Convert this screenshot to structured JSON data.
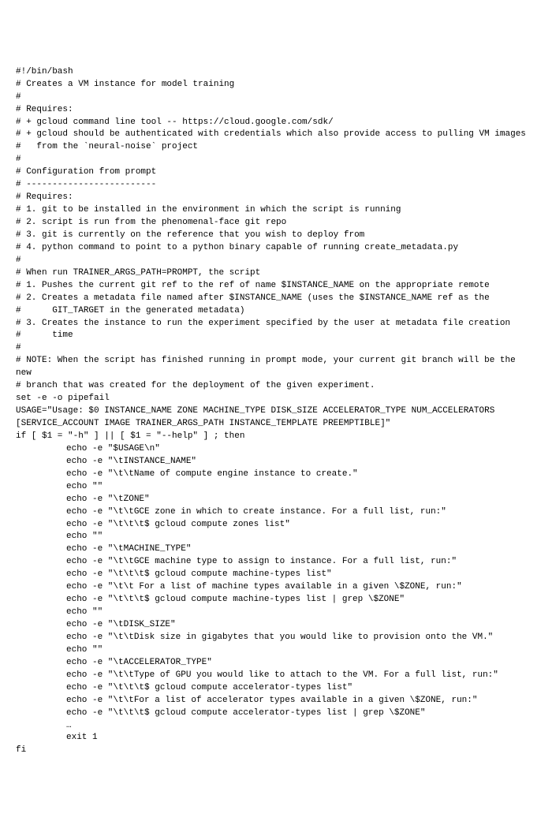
{
  "lines": [
    {
      "text": "#!/bin/bash",
      "class": ""
    },
    {
      "text": "",
      "class": ""
    },
    {
      "text": "# Creates a VM instance for model training",
      "class": ""
    },
    {
      "text": "#",
      "class": ""
    },
    {
      "text": "# Requires:",
      "class": ""
    },
    {
      "text": "# + gcloud command line tool -- https://cloud.google.com/sdk/",
      "class": ""
    },
    {
      "text": "# + gcloud should be authenticated with credentials which also provide access to pulling VM images",
      "class": ""
    },
    {
      "text": "#   from the `neural-noise` project",
      "class": ""
    },
    {
      "text": "#",
      "class": ""
    },
    {
      "text": "# Configuration from prompt",
      "class": ""
    },
    {
      "text": "# -------------------------",
      "class": ""
    },
    {
      "text": "# Requires:",
      "class": ""
    },
    {
      "text": "# 1. git to be installed in the environment in which the script is running",
      "class": ""
    },
    {
      "text": "# 2. script is run from the phenomenal-face git repo",
      "class": ""
    },
    {
      "text": "# 3. git is currently on the reference that you wish to deploy from",
      "class": ""
    },
    {
      "text": "# 4. python command to point to a python binary capable of running create_metadata.py",
      "class": ""
    },
    {
      "text": "#",
      "class": ""
    },
    {
      "text": "# When run TRAINER_ARGS_PATH=PROMPT, the script",
      "class": ""
    },
    {
      "text": "# 1. Pushes the current git ref to the ref of name $INSTANCE_NAME on the appropriate remote",
      "class": ""
    },
    {
      "text": "# 2. Creates a metadata file named after $INSTANCE_NAME (uses the $INSTANCE_NAME ref as the",
      "class": ""
    },
    {
      "text": "#      GIT_TARGET in the generated metadata)",
      "class": ""
    },
    {
      "text": "# 3. Creates the instance to run the experiment specified by the user at metadata file creation",
      "class": ""
    },
    {
      "text": "#      time",
      "class": ""
    },
    {
      "text": "#",
      "class": ""
    },
    {
      "text": "# NOTE: When the script has finished running in prompt mode, your current git branch will be the new",
      "class": ""
    },
    {
      "text": "# branch that was created for the deployment of the given experiment.",
      "class": ""
    },
    {
      "text": "",
      "class": ""
    },
    {
      "text": "set -e -o pipefail",
      "class": ""
    },
    {
      "text": "",
      "class": ""
    },
    {
      "text": "USAGE=\"Usage: $0 INSTANCE_NAME ZONE MACHINE_TYPE DISK_SIZE ACCELERATOR_TYPE NUM_ACCELERATORS [SERVICE_ACCOUNT IMAGE TRAINER_ARGS_PATH INSTANCE_TEMPLATE PREEMPTIBLE]\"",
      "class": ""
    },
    {
      "text": "",
      "class": ""
    },
    {
      "text": "if [ $1 = \"-h\" ] || [ $1 = \"--help\" ] ; then",
      "class": ""
    },
    {
      "text": "echo -e \"$USAGE\\n\"",
      "class": "indent1"
    },
    {
      "text": "",
      "class": ""
    },
    {
      "text": "echo -e \"\\tINSTANCE_NAME\"",
      "class": "indent1"
    },
    {
      "text": "echo -e \"\\t\\tName of compute engine instance to create.\"",
      "class": "indent1"
    },
    {
      "text": "",
      "class": ""
    },
    {
      "text": "echo \"\"",
      "class": "indent1"
    },
    {
      "text": "",
      "class": ""
    },
    {
      "text": "echo -e \"\\tZONE\"",
      "class": "indent1"
    },
    {
      "text": "echo -e \"\\t\\tGCE zone in which to create instance. For a full list, run:\"",
      "class": "indent1"
    },
    {
      "text": "echo -e \"\\t\\t\\t$ gcloud compute zones list\"",
      "class": "indent1"
    },
    {
      "text": "",
      "class": ""
    },
    {
      "text": "echo \"\"",
      "class": "indent1"
    },
    {
      "text": "",
      "class": ""
    },
    {
      "text": "echo -e \"\\tMACHINE_TYPE\"",
      "class": "indent1"
    },
    {
      "text": "echo -e \"\\t\\tGCE machine type to assign to instance. For a full list, run:\"",
      "class": "indent1"
    },
    {
      "text": "echo -e \"\\t\\t\\t$ gcloud compute machine-types list\"",
      "class": "indent1"
    },
    {
      "text": "echo -e \"\\t\\t For a list of machine types available in a given \\$ZONE, run:\"",
      "class": "indent1"
    },
    {
      "text": "echo -e \"\\t\\t\\t$ gcloud compute machine-types list | grep \\$ZONE\"",
      "class": "indent1"
    },
    {
      "text": "",
      "class": ""
    },
    {
      "text": "echo \"\"",
      "class": "indent1"
    },
    {
      "text": "",
      "class": ""
    },
    {
      "text": "echo -e \"\\tDISK_SIZE\"",
      "class": "indent1"
    },
    {
      "text": "echo -e \"\\t\\tDisk size in gigabytes that you would like to provision onto the VM.\"",
      "class": "indent1"
    },
    {
      "text": "",
      "class": ""
    },
    {
      "text": "echo \"\"",
      "class": "indent1"
    },
    {
      "text": "",
      "class": ""
    },
    {
      "text": "echo -e \"\\tACCELERATOR_TYPE\"",
      "class": "indent1"
    },
    {
      "text": "echo -e \"\\t\\tType of GPU you would like to attach to the VM. For a full list, run:\"",
      "class": "indent1"
    },
    {
      "text": "echo -e \"\\t\\t\\t$ gcloud compute accelerator-types list\"",
      "class": "indent1"
    },
    {
      "text": "echo -e \"\\t\\tFor a list of accelerator types available in a given \\$ZONE, run:\"",
      "class": "indent1"
    },
    {
      "text": "echo -e \"\\t\\t\\t$ gcloud compute accelerator-types list | grep \\$ZONE\"",
      "class": "indent1"
    },
    {
      "text": "",
      "class": ""
    },
    {
      "text": "…",
      "class": "indent1"
    },
    {
      "text": "",
      "class": ""
    },
    {
      "text": "exit 1",
      "class": "indent1"
    },
    {
      "text": "fi",
      "class": ""
    }
  ]
}
